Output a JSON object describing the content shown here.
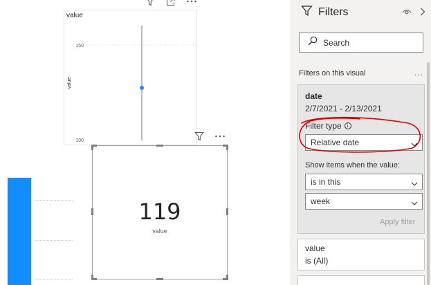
{
  "canvas": {
    "chart": {
      "title": "value",
      "y_axis_label": "value",
      "y_ticks": [
        "150",
        "100"
      ],
      "point_color": "#118dff"
    },
    "card": {
      "value": "119",
      "label": "value"
    },
    "bar_color": "#118dff",
    "header_icons": [
      "filter-icon",
      "focus-mode-icon",
      "more-options-icon"
    ]
  },
  "filters_pane": {
    "title": "Filters",
    "search_placeholder": "Search",
    "section_label": "Filters on this visual",
    "more": "...",
    "date_filter": {
      "field": "date",
      "range": "2/7/2021 - 2/13/2021",
      "filter_type_label": "Filter type",
      "filter_type_value": "Relative date",
      "show_items_label": "Show items when the value:",
      "operator_value": "is in this",
      "unit_value": "week",
      "apply_label": "Apply filter"
    },
    "value_filter": {
      "field": "value",
      "state": "is (All)"
    }
  },
  "annotation_color": "#e00000"
}
